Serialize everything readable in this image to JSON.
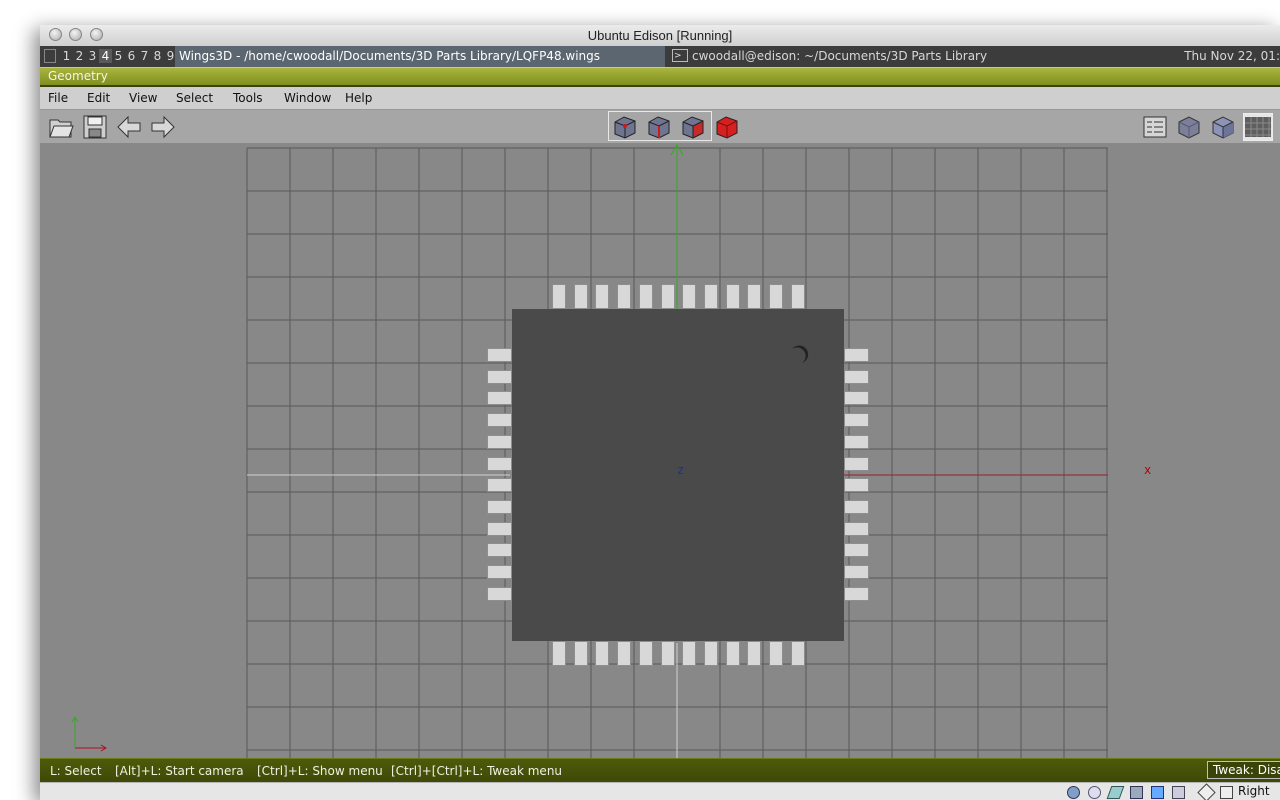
{
  "host_window": {
    "title": "Ubuntu Edison [Running]"
  },
  "guest_panel": {
    "workspaces": [
      "1",
      "2",
      "3",
      "4",
      "5",
      "6",
      "7",
      "8",
      "9"
    ],
    "active_workspace": "4",
    "tasks": [
      "Wings3D - /home/cwoodall/Documents/3D Parts Library/LQFP48.wings",
      "cwoodall@edison: ~/Documents/3D Parts Library"
    ],
    "clock": "Thu Nov 22, 01:"
  },
  "geometry_bar": {
    "title": "Geometry"
  },
  "menu": {
    "items": [
      "File",
      "Edit",
      "View",
      "Select",
      "Tools",
      "Window",
      "Help"
    ]
  },
  "toolbar": {
    "left_icons": [
      "open-folder-icon",
      "save-disk-icon",
      "undo-arrow-icon",
      "redo-arrow-icon"
    ],
    "selection_modes": [
      "vertex-select-icon",
      "edge-select-icon",
      "face-select-icon",
      "object-select-icon"
    ],
    "right_icons": [
      "grid-panel-icon",
      "smooth-cube-icon",
      "flat-cube-icon",
      "wireframe-ground-icon"
    ]
  },
  "viewport": {
    "axis_x_label": "x",
    "axis_z_label": "z",
    "component": {
      "name": "LQFP48",
      "pins_per_side": 12,
      "sides": 4
    }
  },
  "statusbar": {
    "hints": [
      "L: Select",
      "[Alt]+L: Start camera",
      "[Ctrl]+L: Show menu",
      "[Ctrl]+[Ctrl]+L: Tweak menu"
    ],
    "tweak": "Tweak: Disa"
  },
  "vbox_statusbar": {
    "host_key_label": "Right"
  },
  "colors": {
    "viewport_bg": "#888888",
    "grid_line": "#5a5a5a",
    "chip_body": "#4a4a4a",
    "pin": "#d8d8d8",
    "axis_x": "#9c1c2a",
    "axis_y": "#33aa22",
    "axis_z": "#1a2ea0",
    "statusbar": "#4e5a0a",
    "geometry_bar": "#98a530"
  }
}
